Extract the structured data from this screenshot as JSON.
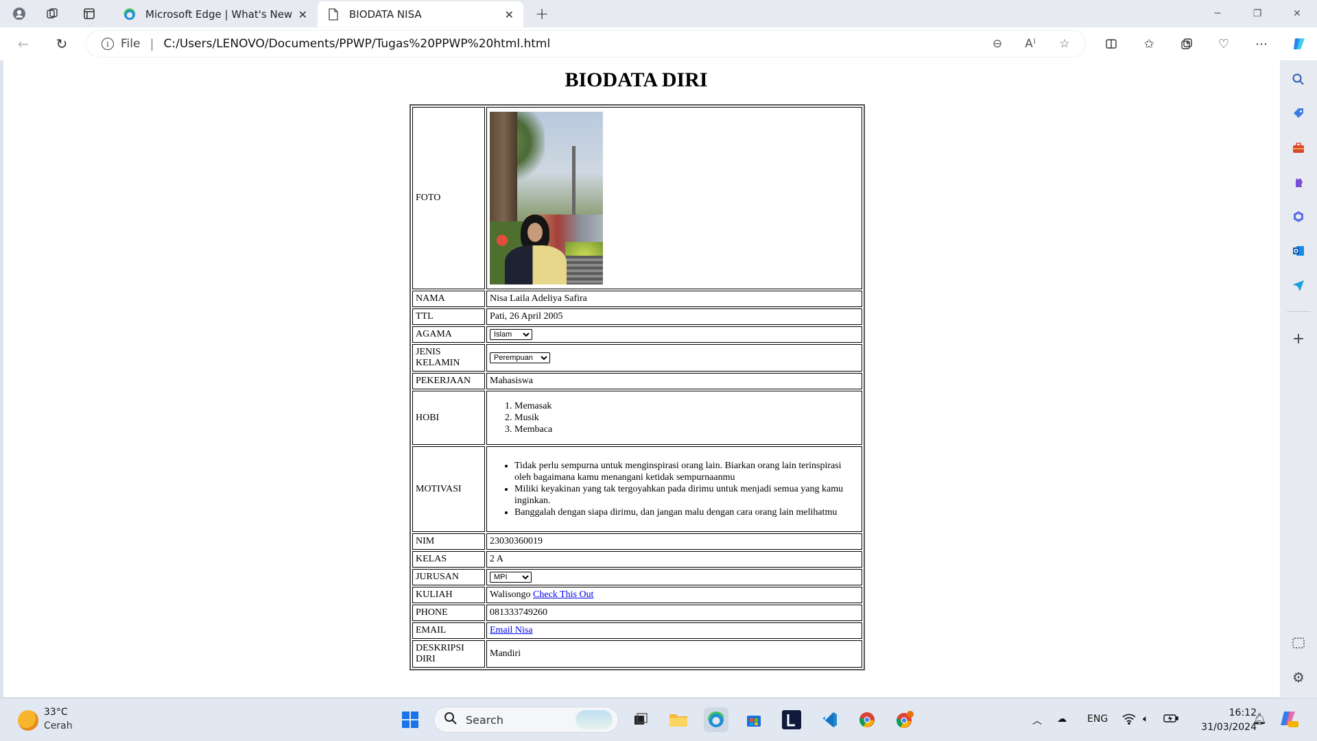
{
  "browser": {
    "tabs": [
      {
        "label": "Microsoft Edge | What's New"
      },
      {
        "label": "BIODATA NISA"
      }
    ],
    "address": {
      "scheme_label": "File",
      "url": "C:/Users/LENOVO/Documents/PPWP/Tugas%20PPWP%20html.html"
    }
  },
  "page": {
    "title": "BIODATA DIRI",
    "rows": {
      "foto_label": "FOTO",
      "nama_label": "NAMA",
      "nama_value": "Nisa Laila Adeliya Safira",
      "ttl_label": "TTL",
      "ttl_value": "Pati, 26 April 2005",
      "agama_label": "AGAMA",
      "agama_selected": "Islam",
      "jk_label": "JENIS KELAMIN",
      "jk_selected": "Perempuan",
      "pekerjaan_label": "PEKERJAAN",
      "pekerjaan_value": "Mahasiswa",
      "hobi_label": "HOBI",
      "hobi": [
        "Memasak",
        "Musik",
        "Membaca"
      ],
      "motivasi_label": "MOTIVASI",
      "motivasi": [
        "Tidak perlu sempurna untuk menginspirasi orang lain. Biarkan orang lain terinspirasi oleh bagaimana kamu menangani ketidak sempurnaanmu",
        "Miliki keyakinan yang tak tergoyahkan pada dirimu untuk menjadi semua yang kamu inginkan.",
        "Banggalah dengan siapa dirimu, dan jangan malu dengan cara orang lain melihatmu"
      ],
      "nim_label": "NIM",
      "nim_value": "23030360019",
      "kelas_label": "KELAS",
      "kelas_value": "2 A",
      "jurusan_label": "JURUSAN",
      "jurusan_selected": "MPI",
      "kuliah_label": "KULIAH",
      "kuliah_value": "Walisongo",
      "kuliah_link": "Check This Out",
      "phone_label": "PHONE",
      "phone_value": "081333749260",
      "email_label": "EMAIL",
      "email_link": "Email Nisa",
      "deskripsi_label": "DESKRIPSI DIRI",
      "deskripsi_value": "Mandiri"
    }
  },
  "taskbar": {
    "weather_temp": "33°C",
    "weather_cond": "Cerah",
    "search_label": "Search",
    "language": "ENG",
    "time": "16:12",
    "date": "31/03/2024"
  },
  "colors": {
    "link": "#0000ee",
    "titlebar_bg": "#e7eaf0",
    "taskbar_bg": "#e2e8f1"
  }
}
